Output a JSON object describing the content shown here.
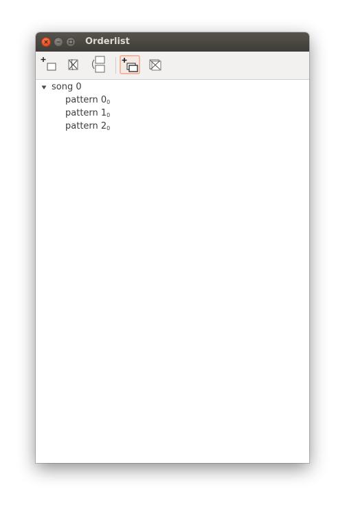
{
  "window": {
    "title": "Orderlist",
    "buttons": [
      "close",
      "minimize",
      "maximize"
    ]
  },
  "toolbar": {
    "buttons": [
      {
        "name": "add-song-button",
        "icon": "add-song-icon"
      },
      {
        "name": "remove-song-button",
        "icon": "remove-song-icon"
      },
      {
        "name": "move-song-button",
        "icon": "move-song-icon"
      },
      {
        "name": "add-pattern-button",
        "icon": "add-pattern-icon",
        "active": true
      },
      {
        "name": "remove-pattern-button",
        "icon": "remove-pattern-icon"
      }
    ]
  },
  "tree": {
    "song": {
      "label": "song 0",
      "expanded": true,
      "patterns": [
        {
          "label": "pattern 0",
          "suffix": "0"
        },
        {
          "label": "pattern 1",
          "suffix": "0"
        },
        {
          "label": "pattern 2",
          "suffix": "0"
        }
      ]
    }
  },
  "colors": {
    "titlebar": "#3f3d38",
    "title_text": "#dfdbd2",
    "close_button": "#e2501f",
    "active_button_border": "#f0b8a4"
  }
}
